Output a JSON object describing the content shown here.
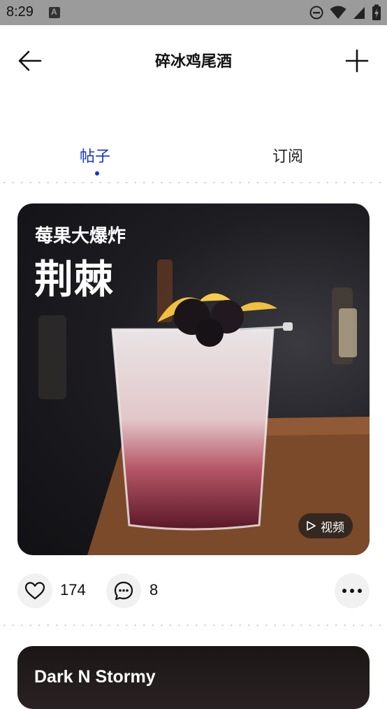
{
  "status_bar": {
    "time": "8:29",
    "notification_letter": "A"
  },
  "app_bar": {
    "title": "碎冰鸡尾酒"
  },
  "tabs": [
    {
      "label": "帖子",
      "active": true
    },
    {
      "label": "订阅",
      "active": false
    }
  ],
  "post": {
    "subtitle": "莓果大爆炸",
    "title": "荆棘",
    "video_label": "视频",
    "like_count": "174",
    "comment_count": "8"
  },
  "next_post": {
    "title": "Dark N Stormy"
  },
  "colors": {
    "accent": "#1233d6",
    "status_bar": "#9b9b9b"
  }
}
